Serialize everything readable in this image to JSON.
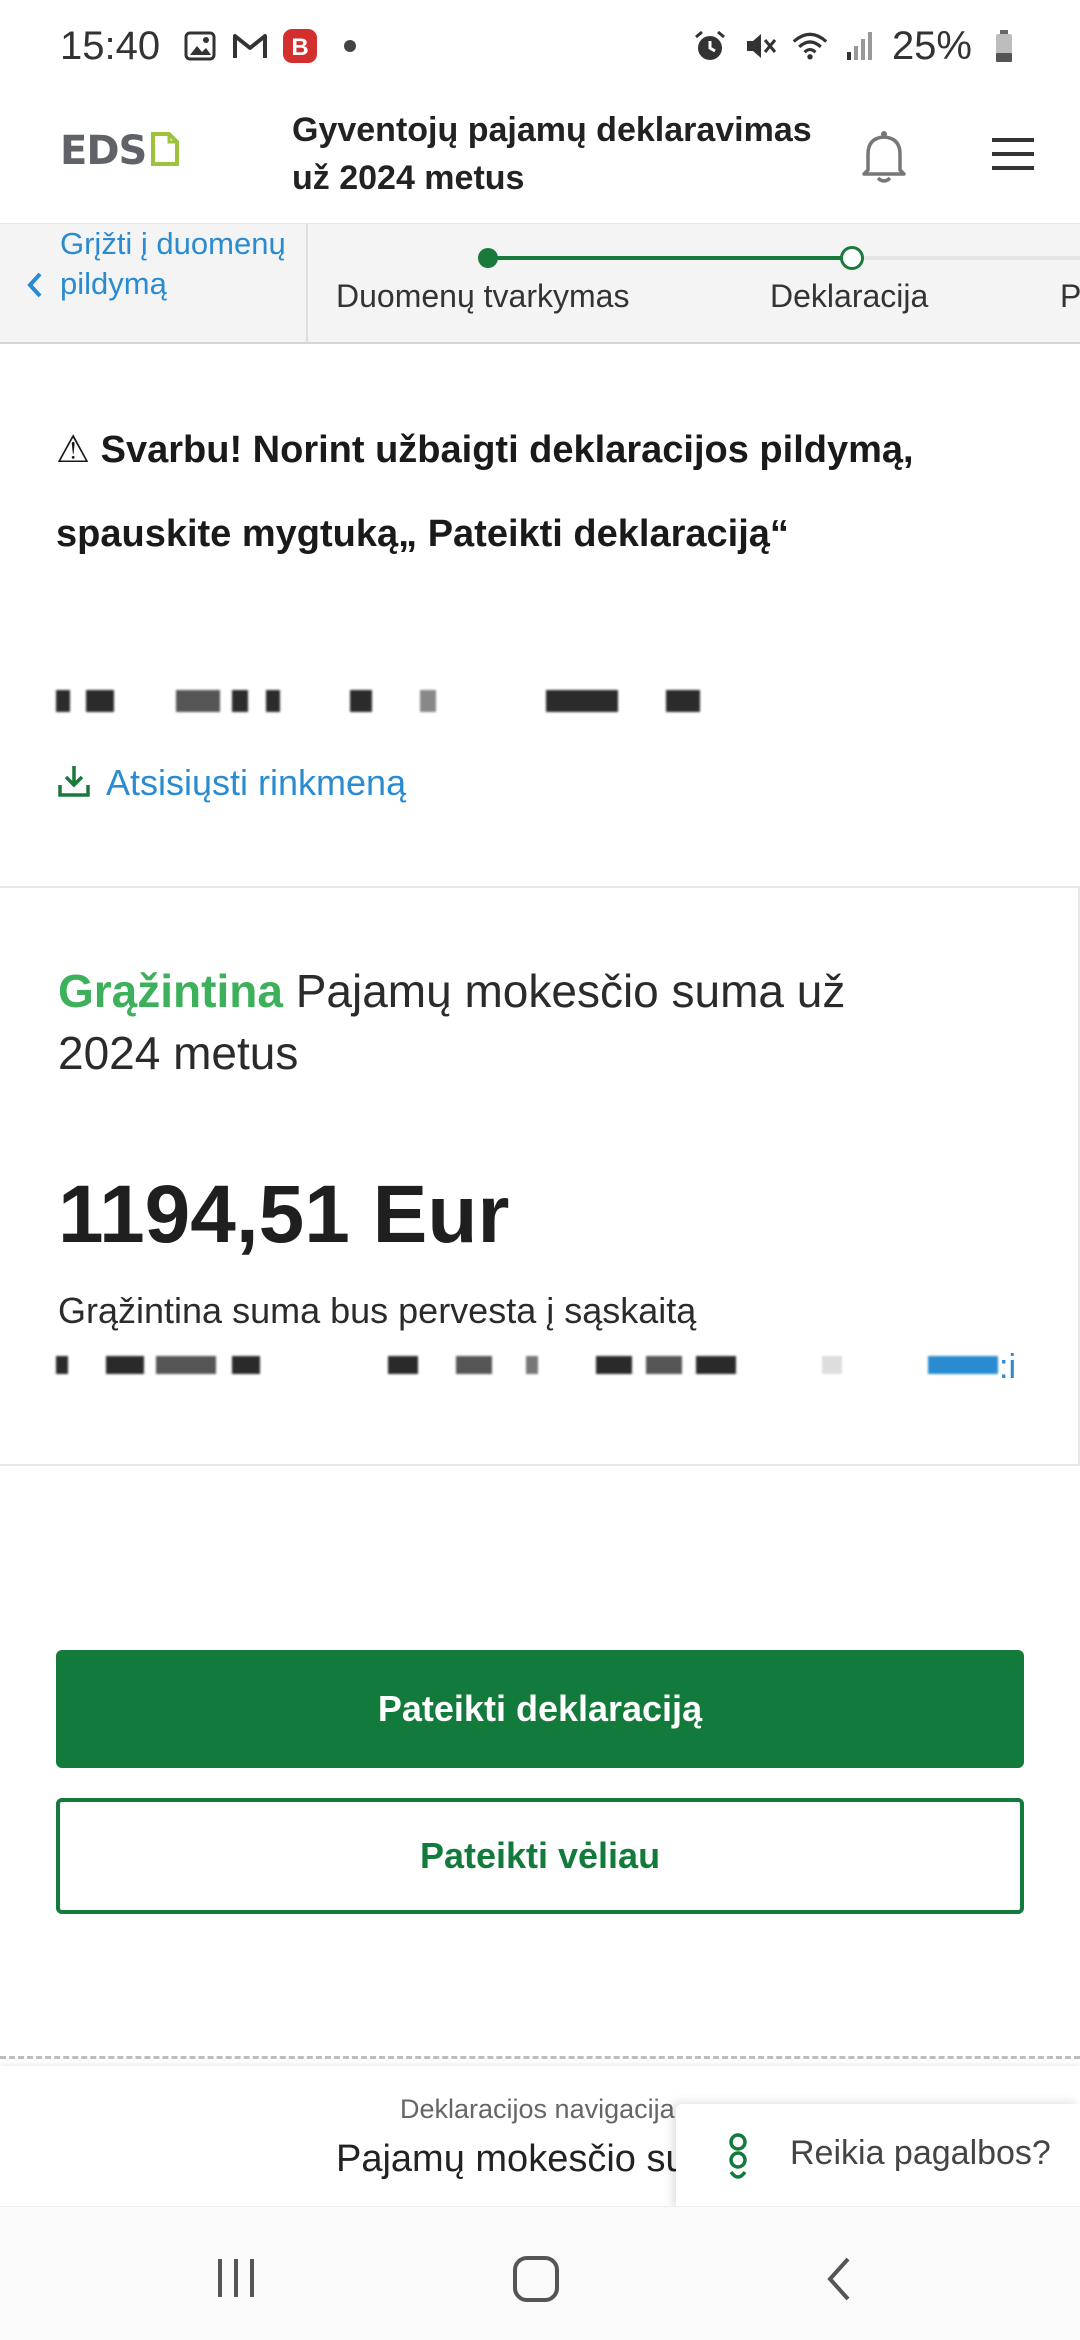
{
  "status_bar": {
    "time": "15:40",
    "battery": "25%",
    "icons_left": [
      "image-icon",
      "gmail-icon",
      "notification-b-icon",
      "dot-icon"
    ],
    "icons_right": [
      "alarm-icon",
      "mute-icon",
      "wifi-icon",
      "signal-icon",
      "battery-icon"
    ]
  },
  "header": {
    "logo": "EDS",
    "title": "Gyventojų pajamų deklaravimas už 2024 metus"
  },
  "stepper": {
    "back_label": "Grįžti į duomenų pildymą",
    "steps": [
      "Duomenų tvarkymas",
      "Deklaracija",
      "P"
    ],
    "active_color": "#1a7a3c"
  },
  "content": {
    "warning": "⚠ Svarbu! Norint užbaigti deklaracijos pildymą, spauskite mygtuką„ Pateikti deklaraciją“",
    "download_label": "Atsisiųsti rinkmeną"
  },
  "summary": {
    "status_word": "Grąžintina",
    "title_rest": " Pajamų mokesčio suma už 2024 metus",
    "amount": "1194,51 Eur",
    "note": "Grąžintina suma bus pervesta į sąskaitą",
    "account_tail": ":i",
    "status_color": "#3cb05a"
  },
  "actions": {
    "submit": "Pateikti deklaraciją",
    "later": "Pateikti vėliau",
    "primary_color": "#127a3a"
  },
  "declaration_nav": {
    "label": "Deklaracijos navigacija",
    "value": "Pajamų mokesčio su"
  },
  "help": {
    "label": "Reikia pagalbos?"
  },
  "system_nav": [
    "recents",
    "home",
    "back"
  ]
}
